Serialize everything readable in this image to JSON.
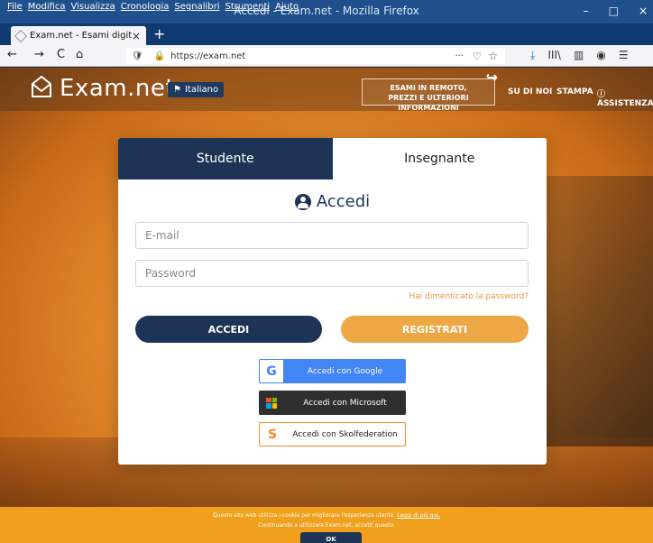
{
  "window": {
    "title": "Accedi - Exam.net - Mozilla Firefox",
    "menu": [
      "File",
      "Modifica",
      "Visualizza",
      "Cronologia",
      "Segnalibri",
      "Strumenti",
      "Aiuto"
    ],
    "controls": {
      "minimize": "–",
      "maximize": "□",
      "close": "×"
    }
  },
  "tab": {
    "title": "Exam.net - Esami digitali",
    "close": "×",
    "new": "+"
  },
  "nav": {
    "back": "←",
    "forward": "→",
    "reload": "C",
    "home": "⌂",
    "url": "https://exam.net",
    "dots": "···",
    "pocket": "♡",
    "star": "☆"
  },
  "toolbar": {
    "download": "⤓",
    "library": "III\\",
    "sidebar": "▥",
    "account": "◉",
    "extensions": "☰"
  },
  "site": {
    "logo": "Exam.net",
    "language": "Italiano",
    "promo_line1": "ESAMI IN REMOTO,",
    "promo_line2": "PREZZI E ULTERIORI INFORMAZIONI",
    "links": [
      "SU DI NOI",
      "STAMPA",
      "ⓘ ASSISTENZA"
    ]
  },
  "login": {
    "tabs": [
      "Studente",
      "Insegnante"
    ],
    "heading": "Accedi",
    "email_placeholder": "E-mail",
    "password_placeholder": "Password",
    "forgot": "Hai dimenticato la password?",
    "login_button": "ACCEDI",
    "register_button": "REGISTRATI",
    "sso": [
      {
        "label": "Accedi con Google",
        "icon": "G"
      },
      {
        "label": "Accedi con Microsoft",
        "icon": "microsoft"
      },
      {
        "label": "Accedi con Skolfederation",
        "icon": "S"
      }
    ]
  },
  "cookie": {
    "line1": "Questo sito web utilizza i cookie per migliorare l'esperienza utente.",
    "more": "Leggi di più qui.",
    "line2": "Continuando a utilizzare Exam.net, accetti questo.",
    "ok": "OK"
  },
  "colors": {
    "navy": "#1d3456",
    "orange": "#eda745",
    "google": "#4285f4",
    "firefox_bar": "#1f4f8c"
  }
}
